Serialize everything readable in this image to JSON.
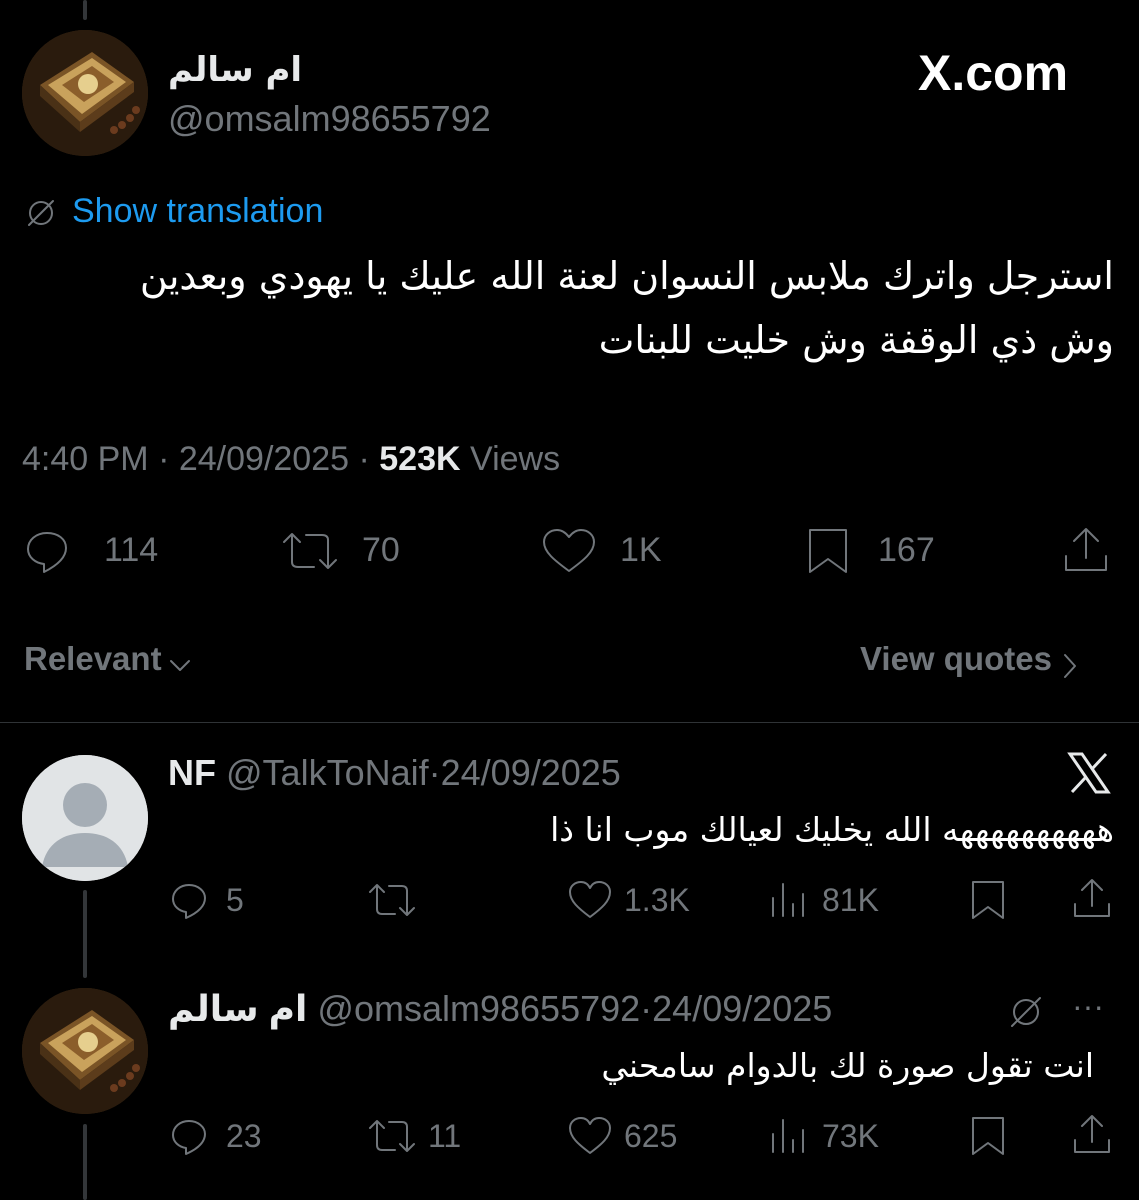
{
  "brand": {
    "logo_text": "X.com"
  },
  "main_tweet": {
    "display_name": "ام سالم",
    "handle": "@omsalm98655792",
    "translate_label": "Show translation",
    "text_line1": "استرجل واترك ملابس النسوان لعنة الله عليك يا يهودي وبعدين",
    "text_line2": "وش ذي الوقفة وش خليت للبنات",
    "time": "4:40 PM",
    "sep1": "·",
    "date": "24/09/2025",
    "sep2": "·",
    "views_count": "523K",
    "views_label": "Views",
    "replies": "114",
    "reposts": "70",
    "likes": "1K",
    "bookmarks": "167"
  },
  "sort": {
    "label": "Relevant",
    "quotes_label": "View quotes"
  },
  "replies": [
    {
      "display_name": "NF",
      "handle": "@TalkToNaif",
      "sep": "·",
      "date": "24/09/2025",
      "text": "ههههههههههه الله يخليك لعيالك موب انا ذا",
      "replies": "5",
      "reposts": "",
      "likes": "1.3K",
      "views": "81K"
    },
    {
      "display_name": "ام سالم",
      "handle": "@omsalm98655792",
      "sep": "·",
      "date": "24/09/2025",
      "more": "···",
      "text": "انت تقول صورة لك بالدوام سامحني",
      "replies": "23",
      "reposts": "11",
      "likes": "625",
      "views": "73K"
    }
  ],
  "colors": {
    "background": "#000000",
    "text": "#e7e9ea",
    "muted": "#71767b",
    "link": "#1d9bf0"
  }
}
